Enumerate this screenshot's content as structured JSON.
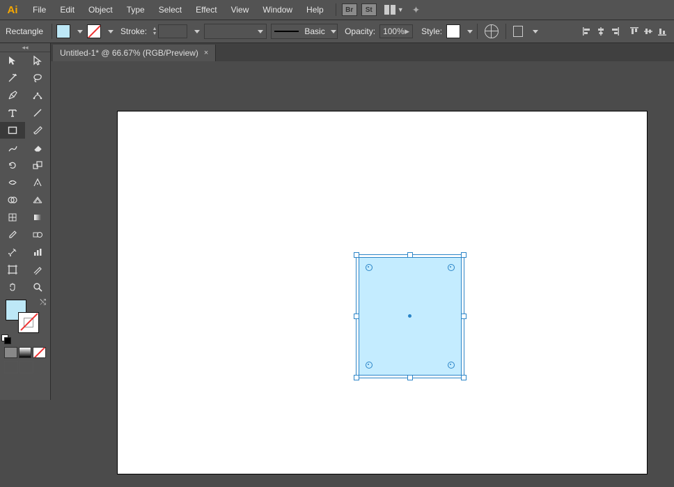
{
  "menu": {
    "items": [
      "File",
      "Edit",
      "Object",
      "Type",
      "Select",
      "Effect",
      "View",
      "Window",
      "Help"
    ],
    "badges": [
      "Br",
      "St"
    ]
  },
  "control": {
    "shape_label": "Rectangle",
    "fill_color": "#bde8f7",
    "stroke_label": "Stroke:",
    "stroke_weight": "",
    "brush_label": "Basic",
    "opacity_label": "Opacity:",
    "opacity_value": "100%",
    "style_label": "Style:"
  },
  "tab": {
    "title": "Untitled-1* @ 66.67% (RGB/Preview)"
  },
  "artwork": {
    "shape_fill": "#c4ecff",
    "shape_stroke": "#2a84c7"
  },
  "tools": {
    "grid": [
      "selection-tool",
      "direct-selection-tool",
      "magic-wand-tool",
      "lasso-tool",
      "pen-tool",
      "curvature-tool",
      "type-tool",
      "line-segment-tool",
      "rectangle-tool",
      "paintbrush-tool",
      "pencil-tool",
      "eraser-tool",
      "rotate-tool",
      "scale-tool",
      "width-tool",
      "free-transform-tool",
      "shape-builder-tool",
      "perspective-grid-tool",
      "mesh-tool",
      "gradient-tool",
      "eyedropper-tool",
      "blend-tool",
      "symbol-sprayer-tool",
      "column-graph-tool",
      "artboard-tool",
      "slice-tool",
      "hand-tool",
      "zoom-tool"
    ],
    "active": "rectangle-tool"
  }
}
